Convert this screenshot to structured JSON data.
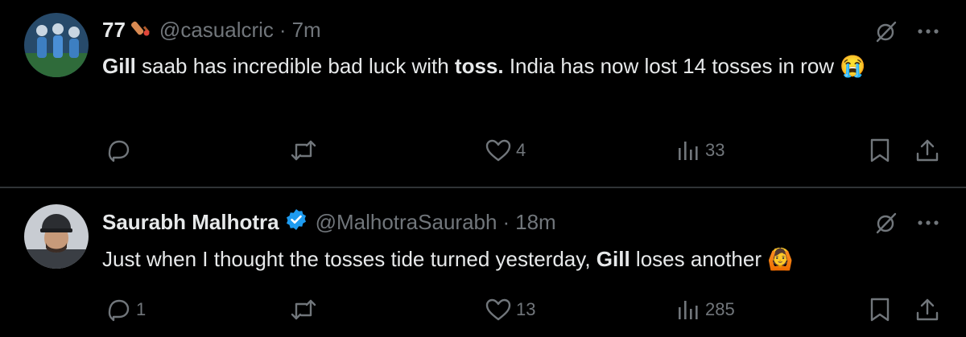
{
  "tweets": [
    {
      "name": "77",
      "handle": "@casualcric",
      "separator": "·",
      "time": "7m",
      "text": [
        {
          "t": "Gill",
          "bold": true
        },
        {
          "t": " saab has incredible bad luck with ",
          "bold": false
        },
        {
          "t": "toss.",
          "bold": true
        },
        {
          "t": " India has now lost 14 tosses in row ",
          "bold": false
        }
      ],
      "emoji": "😭",
      "actions": {
        "reply": "",
        "retweet": "",
        "like": "4",
        "views": "33"
      }
    },
    {
      "name": "Saurabh Malhotra",
      "handle": "@MalhotraSaurabh",
      "separator": "·",
      "time": "18m",
      "text": [
        {
          "t": "Just when I thought the tosses tide turned yesterday, ",
          "bold": false
        },
        {
          "t": "Gill",
          "bold": true
        },
        {
          "t": " loses another ",
          "bold": false
        }
      ],
      "emoji": "🙆",
      "actions": {
        "reply": "1",
        "retweet": "",
        "like": "13",
        "views": "285"
      }
    }
  ],
  "colors": {
    "background": "#000000",
    "text": "#e7e9ea",
    "muted": "#71767b",
    "verified": "#1d9bf0",
    "divider": "#2f3336"
  },
  "icons": [
    "grok-icon",
    "more-icon",
    "reply-icon",
    "retweet-icon",
    "like-icon",
    "views-icon",
    "bookmark-icon",
    "share-icon",
    "verified-badge-icon",
    "cricket-bat-icon"
  ]
}
